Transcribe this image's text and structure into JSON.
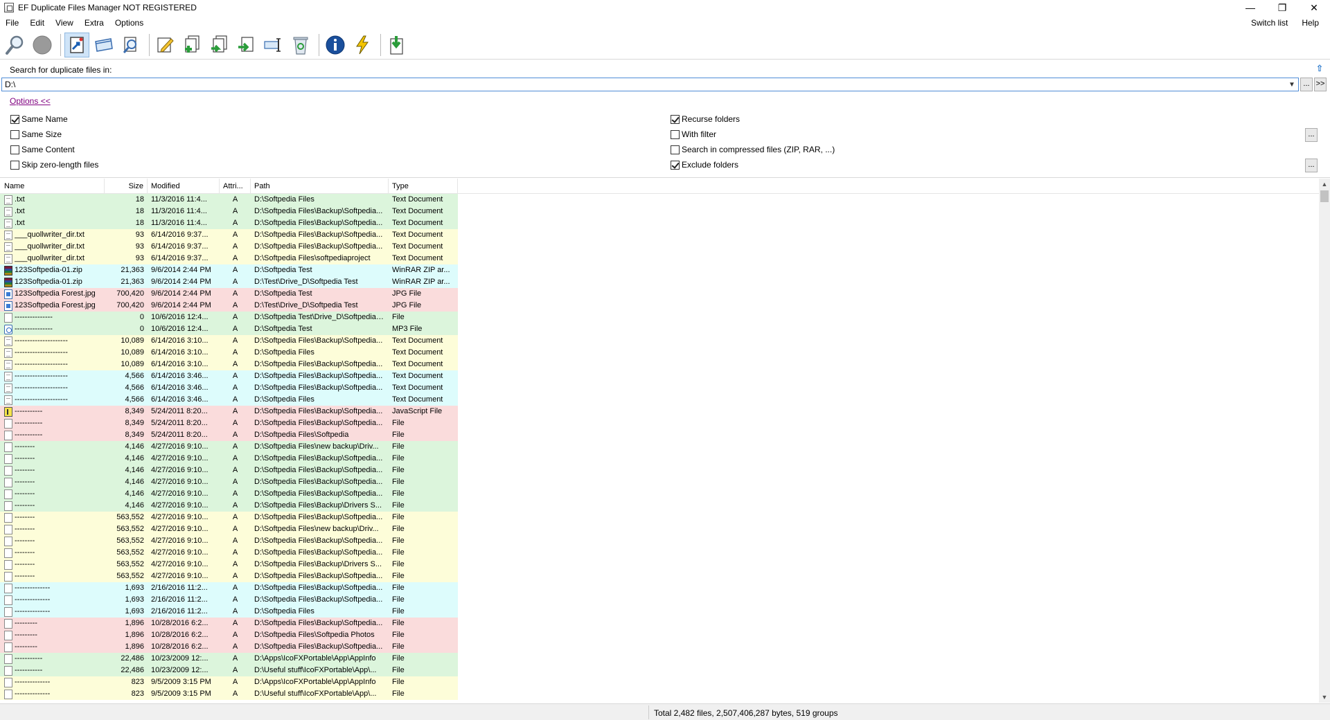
{
  "window": {
    "title": "EF Duplicate Files Manager NOT REGISTERED",
    "minimize": "—",
    "restore": "❐",
    "close": "✕"
  },
  "menu": {
    "items": [
      "File",
      "Edit",
      "View",
      "Extra",
      "Options"
    ],
    "right_items": [
      "Switch list",
      "Help"
    ]
  },
  "toolbar": {
    "buttons": [
      "search-icon",
      "stop-icon",
      "open-file-icon",
      "window-icon",
      "find-icon",
      "edit-icon",
      "add-icon",
      "copy-icon",
      "move-icon",
      "rename-icon",
      "recycle-icon",
      "info-icon",
      "lightning-icon",
      "download-icon"
    ]
  },
  "search": {
    "label": "Search for duplicate files in:",
    "path": "D:\\",
    "browse_label": "...",
    "more_label": ">>"
  },
  "options": {
    "link": "Options  <<",
    "same_name": "Same Name",
    "same_size": "Same Size",
    "same_content": "Same Content",
    "skip_zero": "Skip zero-length files",
    "recurse": "Recurse folders",
    "with_filter": "With filter",
    "compressed": "Search in compressed files (ZIP, RAR, ...)",
    "exclude": "Exclude folders",
    "ellipsis": "..."
  },
  "table": {
    "headers": {
      "name": "Name",
      "size": "Size",
      "modified": "Modified",
      "attr": "Attri...",
      "path": "Path",
      "type": "Type"
    },
    "rows": [
      {
        "icon": "txt",
        "color": "green",
        "name": ".txt",
        "size": "18",
        "modified": "11/3/2016  11:4...",
        "attr": "A",
        "path": "D:\\Softpedia Files",
        "type": "Text Document"
      },
      {
        "icon": "txt",
        "color": "green",
        "name": ".txt",
        "size": "18",
        "modified": "11/3/2016  11:4...",
        "attr": "A",
        "path": "D:\\Softpedia Files\\Backup\\Softpedia...",
        "type": "Text Document"
      },
      {
        "icon": "txt",
        "color": "green",
        "name": ".txt",
        "size": "18",
        "modified": "11/3/2016  11:4...",
        "attr": "A",
        "path": "D:\\Softpedia Files\\Backup\\Softpedia...",
        "type": "Text Document"
      },
      {
        "icon": "txt",
        "color": "yellow",
        "name": "___quollwriter_dir.txt",
        "size": "93",
        "modified": "6/14/2016  9:37...",
        "attr": "A",
        "path": "D:\\Softpedia Files\\Backup\\Softpedia...",
        "type": "Text Document"
      },
      {
        "icon": "txt",
        "color": "yellow",
        "name": "___quollwriter_dir.txt",
        "size": "93",
        "modified": "6/14/2016  9:37...",
        "attr": "A",
        "path": "D:\\Softpedia Files\\Backup\\Softpedia...",
        "type": "Text Document"
      },
      {
        "icon": "txt",
        "color": "yellow",
        "name": "___quollwriter_dir.txt",
        "size": "93",
        "modified": "6/14/2016  9:37...",
        "attr": "A",
        "path": "D:\\Softpedia Files\\softpediaproject",
        "type": "Text Document"
      },
      {
        "icon": "zip",
        "color": "cyan",
        "name": "123Softpedia-01.zip",
        "size": "21,363",
        "modified": "9/6/2014  2:44 PM",
        "attr": "A",
        "path": "D:\\Softpedia Test",
        "type": "WinRAR ZIP ar..."
      },
      {
        "icon": "zip",
        "color": "cyan",
        "name": "123Softpedia-01.zip",
        "size": "21,363",
        "modified": "9/6/2014  2:44 PM",
        "attr": "A",
        "path": "D:\\Test\\Drive_D\\Softpedia Test",
        "type": "WinRAR ZIP ar..."
      },
      {
        "icon": "jpg",
        "color": "pink",
        "name": "123Softpedia Forest.jpg",
        "size": "700,420",
        "modified": "9/6/2014  2:44 PM",
        "attr": "A",
        "path": "D:\\Softpedia Test",
        "type": "JPG File"
      },
      {
        "icon": "jpg",
        "color": "pink",
        "name": "123Softpedia Forest.jpg",
        "size": "700,420",
        "modified": "9/6/2014  2:44 PM",
        "attr": "A",
        "path": "D:\\Test\\Drive_D\\Softpedia Test",
        "type": "JPG File"
      },
      {
        "icon": "blank",
        "color": "green",
        "name": "---------------",
        "size": "0",
        "modified": "10/6/2016  12:4...",
        "attr": "A",
        "path": "D:\\Softpedia Test\\Drive_D\\Softpedia Test",
        "type": "File"
      },
      {
        "icon": "mp3",
        "color": "green",
        "name": "---------------",
        "size": "0",
        "modified": "10/6/2016  12:4...",
        "attr": "A",
        "path": "D:\\Softpedia Test",
        "type": "MP3 File"
      },
      {
        "icon": "txt",
        "color": "yellow",
        "name": "---------------------",
        "size": "10,089",
        "modified": "6/14/2016  3:10...",
        "attr": "A",
        "path": "D:\\Softpedia Files\\Backup\\Softpedia...",
        "type": "Text Document"
      },
      {
        "icon": "txt",
        "color": "yellow",
        "name": "---------------------",
        "size": "10,089",
        "modified": "6/14/2016  3:10...",
        "attr": "A",
        "path": "D:\\Softpedia Files",
        "type": "Text Document"
      },
      {
        "icon": "txt",
        "color": "yellow",
        "name": "---------------------",
        "size": "10,089",
        "modified": "6/14/2016  3:10...",
        "attr": "A",
        "path": "D:\\Softpedia Files\\Backup\\Softpedia...",
        "type": "Text Document"
      },
      {
        "icon": "txt",
        "color": "cyan",
        "name": "---------------------",
        "size": "4,566",
        "modified": "6/14/2016  3:46...",
        "attr": "A",
        "path": "D:\\Softpedia Files\\Backup\\Softpedia...",
        "type": "Text Document"
      },
      {
        "icon": "txt",
        "color": "cyan",
        "name": "---------------------",
        "size": "4,566",
        "modified": "6/14/2016  3:46...",
        "attr": "A",
        "path": "D:\\Softpedia Files\\Backup\\Softpedia...",
        "type": "Text Document"
      },
      {
        "icon": "txt",
        "color": "cyan",
        "name": "---------------------",
        "size": "4,566",
        "modified": "6/14/2016  3:46...",
        "attr": "A",
        "path": "D:\\Softpedia Files",
        "type": "Text Document"
      },
      {
        "icon": "js",
        "color": "pink",
        "name": "-----------",
        "size": "8,349",
        "modified": "5/24/2011  8:20...",
        "attr": "A",
        "path": "D:\\Softpedia Files\\Backup\\Softpedia...",
        "type": "JavaScript File"
      },
      {
        "icon": "blank",
        "color": "pink",
        "name": "-----------",
        "size": "8,349",
        "modified": "5/24/2011  8:20...",
        "attr": "A",
        "path": "D:\\Softpedia Files\\Backup\\Softpedia...",
        "type": "File"
      },
      {
        "icon": "blank",
        "color": "pink",
        "name": "-----------",
        "size": "8,349",
        "modified": "5/24/2011  8:20...",
        "attr": "A",
        "path": "D:\\Softpedia Files\\Softpedia",
        "type": "File"
      },
      {
        "icon": "blank",
        "color": "green",
        "name": "--------",
        "size": "4,146",
        "modified": "4/27/2016  9:10...",
        "attr": "A",
        "path": "D:\\Softpedia Files\\new backup\\Driv...",
        "type": "File"
      },
      {
        "icon": "blank",
        "color": "green",
        "name": "--------",
        "size": "4,146",
        "modified": "4/27/2016  9:10...",
        "attr": "A",
        "path": "D:\\Softpedia Files\\Backup\\Softpedia...",
        "type": "File"
      },
      {
        "icon": "blank",
        "color": "green",
        "name": "--------",
        "size": "4,146",
        "modified": "4/27/2016  9:10...",
        "attr": "A",
        "path": "D:\\Softpedia Files\\Backup\\Softpedia...",
        "type": "File"
      },
      {
        "icon": "blank",
        "color": "green",
        "name": "--------",
        "size": "4,146",
        "modified": "4/27/2016  9:10...",
        "attr": "A",
        "path": "D:\\Softpedia Files\\Backup\\Softpedia...",
        "type": "File"
      },
      {
        "icon": "blank",
        "color": "green",
        "name": "--------",
        "size": "4,146",
        "modified": "4/27/2016  9:10...",
        "attr": "A",
        "path": "D:\\Softpedia Files\\Backup\\Softpedia...",
        "type": "File"
      },
      {
        "icon": "blank",
        "color": "green",
        "name": "--------",
        "size": "4,146",
        "modified": "4/27/2016  9:10...",
        "attr": "A",
        "path": "D:\\Softpedia Files\\Backup\\Drivers S...",
        "type": "File"
      },
      {
        "icon": "blank",
        "color": "yellow",
        "name": "--------",
        "size": "563,552",
        "modified": "4/27/2016  9:10...",
        "attr": "A",
        "path": "D:\\Softpedia Files\\Backup\\Softpedia...",
        "type": "File"
      },
      {
        "icon": "blank",
        "color": "yellow",
        "name": "--------",
        "size": "563,552",
        "modified": "4/27/2016  9:10...",
        "attr": "A",
        "path": "D:\\Softpedia Files\\new backup\\Driv...",
        "type": "File"
      },
      {
        "icon": "blank",
        "color": "yellow",
        "name": "--------",
        "size": "563,552",
        "modified": "4/27/2016  9:10...",
        "attr": "A",
        "path": "D:\\Softpedia Files\\Backup\\Softpedia...",
        "type": "File"
      },
      {
        "icon": "blank",
        "color": "yellow",
        "name": "--------",
        "size": "563,552",
        "modified": "4/27/2016  9:10...",
        "attr": "A",
        "path": "D:\\Softpedia Files\\Backup\\Softpedia...",
        "type": "File"
      },
      {
        "icon": "blank",
        "color": "yellow",
        "name": "--------",
        "size": "563,552",
        "modified": "4/27/2016  9:10...",
        "attr": "A",
        "path": "D:\\Softpedia Files\\Backup\\Drivers S...",
        "type": "File"
      },
      {
        "icon": "blank",
        "color": "yellow",
        "name": "--------",
        "size": "563,552",
        "modified": "4/27/2016  9:10...",
        "attr": "A",
        "path": "D:\\Softpedia Files\\Backup\\Softpedia...",
        "type": "File"
      },
      {
        "icon": "blank",
        "color": "cyan",
        "name": "--------------",
        "size": "1,693",
        "modified": "2/16/2016  11:2...",
        "attr": "A",
        "path": "D:\\Softpedia Files\\Backup\\Softpedia...",
        "type": "File"
      },
      {
        "icon": "blank",
        "color": "cyan",
        "name": "--------------",
        "size": "1,693",
        "modified": "2/16/2016  11:2...",
        "attr": "A",
        "path": "D:\\Softpedia Files\\Backup\\Softpedia...",
        "type": "File"
      },
      {
        "icon": "blank",
        "color": "cyan",
        "name": "--------------",
        "size": "1,693",
        "modified": "2/16/2016  11:2...",
        "attr": "A",
        "path": "D:\\Softpedia Files",
        "type": "File"
      },
      {
        "icon": "blank",
        "color": "pink",
        "name": "---------",
        "size": "1,896",
        "modified": "10/28/2016  6:2...",
        "attr": "A",
        "path": "D:\\Softpedia Files\\Backup\\Softpedia...",
        "type": "File"
      },
      {
        "icon": "blank",
        "color": "pink",
        "name": "---------",
        "size": "1,896",
        "modified": "10/28/2016  6:2...",
        "attr": "A",
        "path": "D:\\Softpedia Files\\Softpedia Photos",
        "type": "File"
      },
      {
        "icon": "blank",
        "color": "pink",
        "name": "---------",
        "size": "1,896",
        "modified": "10/28/2016  6:2...",
        "attr": "A",
        "path": "D:\\Softpedia Files\\Backup\\Softpedia...",
        "type": "File"
      },
      {
        "icon": "blank",
        "color": "green",
        "name": "-----------",
        "size": "22,486",
        "modified": "10/23/2009  12:...",
        "attr": "A",
        "path": "D:\\Apps\\IcoFXPortable\\App\\AppInfo",
        "type": "File"
      },
      {
        "icon": "blank",
        "color": "green",
        "name": "-----------",
        "size": "22,486",
        "modified": "10/23/2009  12:...",
        "attr": "A",
        "path": "D:\\Useful stuff\\IcoFXPortable\\App\\...",
        "type": "File"
      },
      {
        "icon": "blank",
        "color": "yellow",
        "name": "--------------",
        "size": "823",
        "modified": "9/5/2009  3:15 PM",
        "attr": "A",
        "path": "D:\\Apps\\IcoFXPortable\\App\\AppInfo",
        "type": "File"
      },
      {
        "icon": "blank",
        "color": "yellow",
        "name": "--------------",
        "size": "823",
        "modified": "9/5/2009  3:15 PM",
        "attr": "A",
        "path": "D:\\Useful stuff\\IcoFXPortable\\App\\...",
        "type": "File"
      }
    ]
  },
  "status": {
    "text": "Total 2,482 files, 2,507,406,287 bytes, 519 groups"
  }
}
